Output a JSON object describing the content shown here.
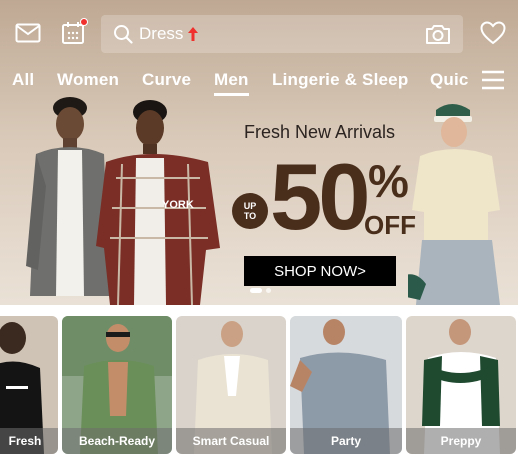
{
  "header": {
    "search_value": "Dress",
    "icons": [
      "mail-icon",
      "calendar-icon",
      "search-icon",
      "trending-up-arrow-icon",
      "camera-icon",
      "heart-icon"
    ]
  },
  "tabs": [
    {
      "label": "All",
      "active": false
    },
    {
      "label": "Women",
      "active": false
    },
    {
      "label": "Curve",
      "active": false
    },
    {
      "label": "Men",
      "active": true
    },
    {
      "label": "Lingerie & Sleep",
      "active": false
    },
    {
      "label": "Quic",
      "active": false
    }
  ],
  "banner": {
    "headline": "Fresh New Arrivals",
    "upto_line1": "UP",
    "upto_line2": "TO",
    "discount": "50",
    "percent": "%",
    "off": "OFF",
    "cta": "SHOP NOW>",
    "slide_count": 2,
    "active_slide": 1,
    "shirt_text": "YORK"
  },
  "categories": [
    {
      "label": "Fresh"
    },
    {
      "label": "Beach-Ready"
    },
    {
      "label": "Smart Casual"
    },
    {
      "label": "Party"
    },
    {
      "label": "Preppy"
    }
  ],
  "colors": {
    "accent_brown": "#4a2e1c",
    "badge_red": "#f0302c",
    "cta_black": "#000000",
    "label_overlay": "#6e6e6e"
  }
}
